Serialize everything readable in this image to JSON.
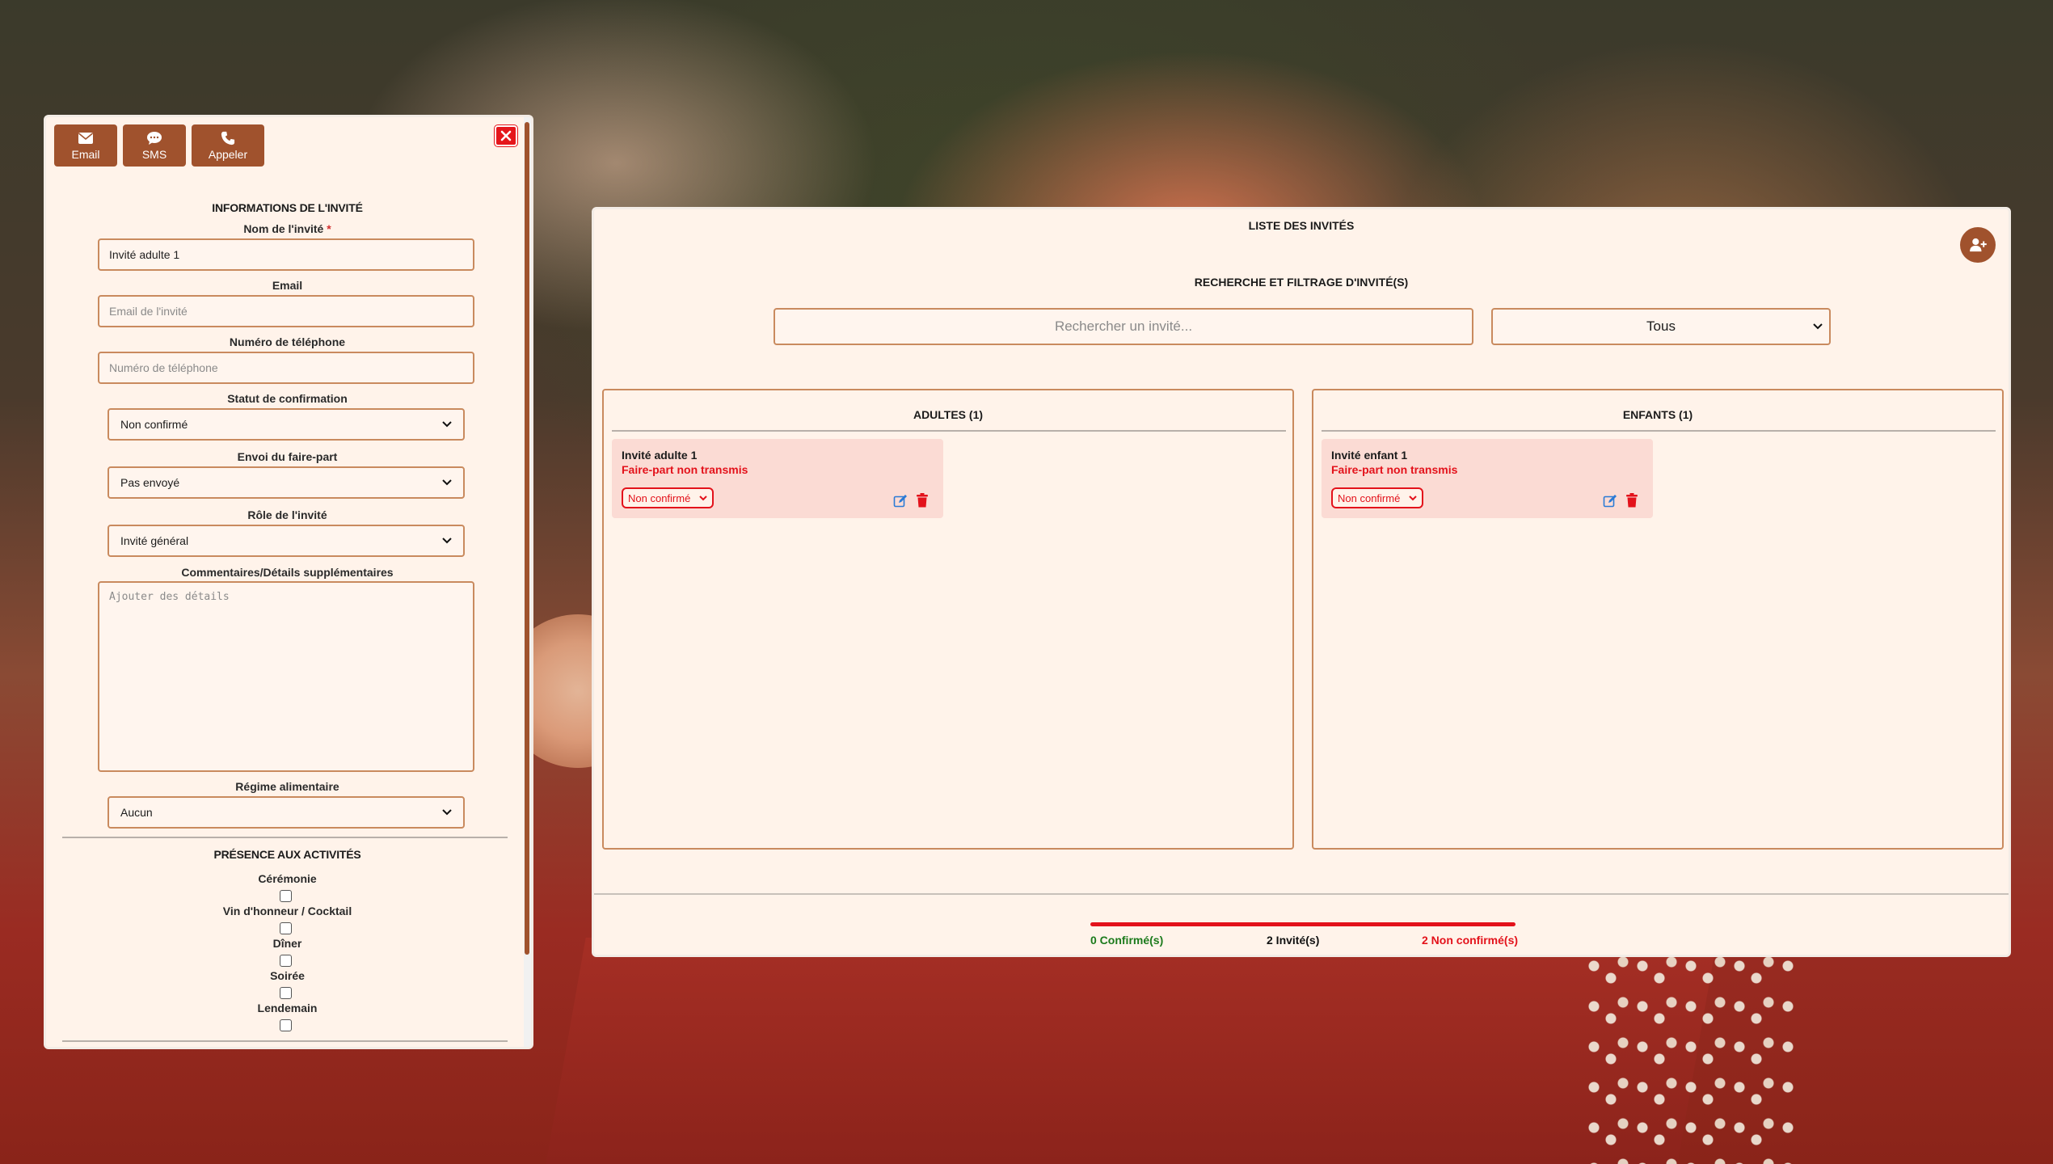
{
  "left_panel": {
    "buttons": {
      "email": "Email",
      "sms": "SMS",
      "call": "Appeler"
    },
    "section_title": "INFORMATIONS DE L'INVITÉ",
    "name_label": "Nom de l'invité",
    "required_mark": "*",
    "name_value": "Invité adulte 1",
    "email_label": "Email",
    "email_placeholder": "Email de l'invité",
    "phone_label": "Numéro de téléphone",
    "phone_placeholder": "Numéro de téléphone",
    "status_label": "Statut de confirmation",
    "status_value": "Non confirmé",
    "invite_label": "Envoi du faire-part",
    "invite_value": "Pas envoyé",
    "role_label": "Rôle de l'invité",
    "role_value": "Invité général",
    "comments_label": "Commentaires/Détails supplémentaires",
    "comments_placeholder": "Ajouter des détails",
    "diet_label": "Régime alimentaire",
    "diet_value": "Aucun",
    "activities_title": "PRÉSENCE AUX ACTIVITÉS",
    "activities": [
      "Cérémonie",
      "Vin d'honneur / Cocktail",
      "Dîner",
      "Soirée",
      "Lendemain"
    ]
  },
  "right_panel": {
    "title": "LISTE DES INVITÉS",
    "subtitle": "RECHERCHE ET FILTRAGE D'INVITÉ(S)",
    "search_placeholder": "Rechercher un invité...",
    "filter_value": "Tous",
    "adults": {
      "title": "ADULTES (1)",
      "card": {
        "name": "Invité adulte 1",
        "status": "Faire-part non transmis",
        "select": "Non confirmé"
      }
    },
    "children": {
      "title": "ENFANTS (1)",
      "card": {
        "name": "Invité enfant 1",
        "status": "Faire-part non transmis",
        "select": "Non confirmé"
      }
    },
    "footer": {
      "confirmed": "0 Confirmé(s)",
      "total": "2 Invité(s)",
      "unconfirmed": "2 Non confirmé(s)"
    }
  },
  "colors": {
    "accent": "#a0522d",
    "danger": "#e3121b",
    "success": "#1b7a1b",
    "panel": "#fff3ea"
  }
}
